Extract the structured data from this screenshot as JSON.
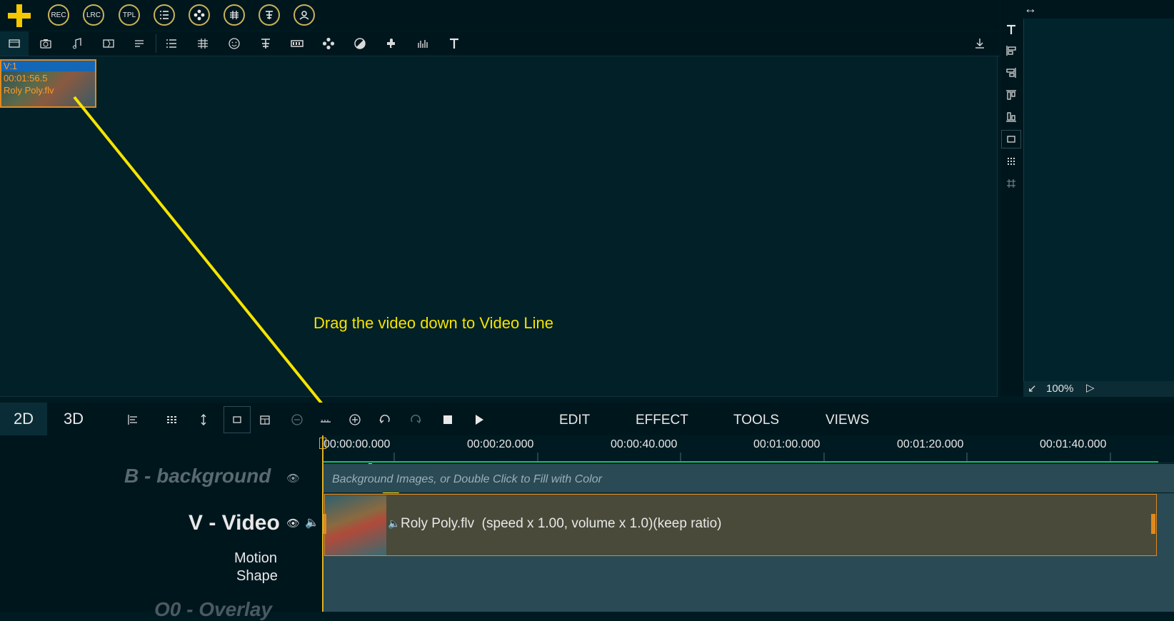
{
  "top_toolbar": {
    "add_label": "+",
    "buttons": [
      {
        "label": "REC",
        "icon": "rec-icon"
      },
      {
        "label": "LRC",
        "icon": "lrc-icon"
      },
      {
        "label": "TPL",
        "icon": "template-icon"
      },
      {
        "label": "",
        "icon": "list-icon"
      },
      {
        "label": "",
        "icon": "flower-icon"
      },
      {
        "label": "",
        "icon": "music-score-icon"
      },
      {
        "label": "",
        "icon": "text-align-icon"
      },
      {
        "label": "",
        "icon": "user-icon"
      }
    ]
  },
  "media_tabs": [
    "video-icon",
    "camera-icon",
    "music-icon",
    "transition-icon",
    "subtitle-icon",
    "list-icon",
    "score-icon",
    "emoji-icon",
    "text-icon",
    "filmstrip-icon",
    "flower-icon",
    "contrast-icon",
    "puzzle-icon",
    "equalizer-icon",
    "title-icon"
  ],
  "thumbnail": {
    "track": "V:1",
    "duration": "00:01:56.5",
    "filename": "Roly Poly.flv"
  },
  "annotation": "Drag the video down to Video Line",
  "right_panel": {
    "resize_glyph": "↔",
    "zoom": "100%",
    "icons": [
      "text-icon",
      "align-left-icon",
      "align-right-icon",
      "align-top-icon",
      "align-bottom-icon",
      "frame-icon",
      "grid-dots-icon",
      "grid-icon"
    ]
  },
  "mode_tabs": {
    "two_d": "2D",
    "three_d": "3D"
  },
  "menus": {
    "edit": "EDIT",
    "effect": "EFFECT",
    "tools": "TOOLS",
    "views": "VIEWS"
  },
  "timeline": {
    "ticks": [
      "00:00:00.000",
      "00:00:20.000",
      "00:00:40.000",
      "00:01:00.000",
      "00:01:20.000",
      "00:01:40.000"
    ],
    "tracks": {
      "background_label": "B - background",
      "background_hint": "Background Images, or Double Click to Fill with Color",
      "video_label": "V - Video",
      "motion_label": "Motion",
      "shape_label": "Shape",
      "overlay_label": "O0 - Overlay"
    },
    "clip": {
      "text": "Roly Poly.flv  (speed x 1.00, volume x 1.0)(keep ratio)"
    }
  },
  "colors": {
    "accent": "#f5e400",
    "clip_border": "#e08a1e",
    "selection": "#1267b8"
  }
}
